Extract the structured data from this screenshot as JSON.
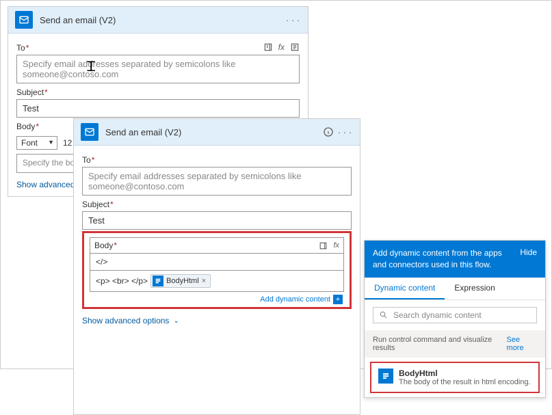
{
  "card1": {
    "title": "Send an email (V2)",
    "to_label": "To",
    "to_placeholder": "Specify email addresses separated by semicolons like someone@contoso.com",
    "subject_label": "Subject",
    "subject_value": "Test",
    "body_label": "Body",
    "font_label": "Font",
    "font_size": "12",
    "body_placeholder": "Specify the body of the",
    "adv_link": "Show advanced options"
  },
  "card2": {
    "title": "Send an email (V2)",
    "to_label": "To",
    "to_placeholder": "Specify email addresses separated by semicolons like someone@contoso.com",
    "subject_label": "Subject",
    "subject_value": "Test",
    "body_label": "Body",
    "code_tag": "</>",
    "html_prefix": "<p> <br> </p>",
    "token_label": "BodyHtml",
    "add_dyn": "Add dynamic content",
    "adv_link": "Show advanced options"
  },
  "dyn": {
    "head": "Add dynamic content from the apps and connectors used in this flow.",
    "hide": "Hide",
    "tab1": "Dynamic content",
    "tab2": "Expression",
    "search_placeholder": "Search dynamic content",
    "group": "Run control command and visualize results",
    "seemore": "See more",
    "item_title": "BodyHtml",
    "item_desc": "The body of the result in html encoding."
  }
}
